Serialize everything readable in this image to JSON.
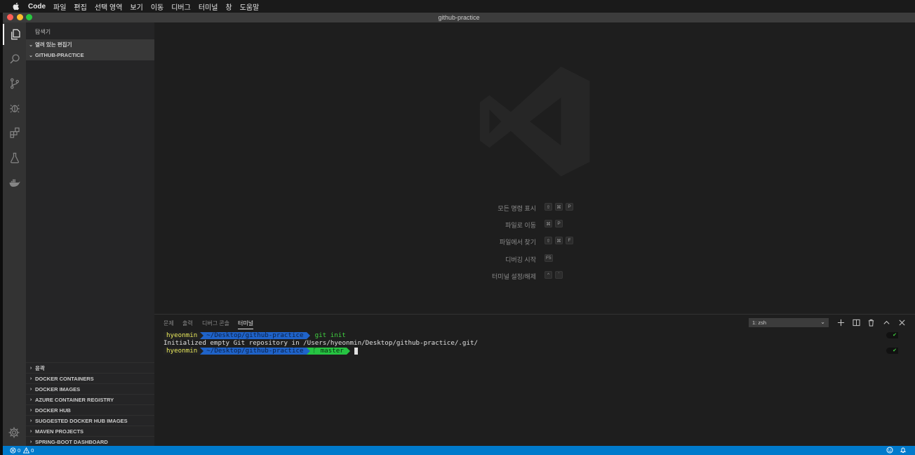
{
  "menubar": {
    "app": "Code",
    "items": [
      "파일",
      "편집",
      "선택 영역",
      "보기",
      "이동",
      "디버그",
      "터미널",
      "창",
      "도움말"
    ]
  },
  "window": {
    "title": "github-practice"
  },
  "activity_bar": {
    "icons": [
      "explorer-icon",
      "search-icon",
      "source-control-icon",
      "debug-icon",
      "extensions-icon",
      "test-flask-icon",
      "docker-icon"
    ],
    "settings_icon": "gear-icon"
  },
  "sidebar": {
    "title": "탐색기",
    "open_editors": "열려 있는 편집기",
    "project": "GITHUB-PRACTICE",
    "sections": [
      "윤곽",
      "DOCKER CONTAINERS",
      "DOCKER IMAGES",
      "AZURE CONTAINER REGISTRY",
      "DOCKER HUB",
      "SUGGESTED DOCKER HUB IMAGES",
      "MAVEN PROJECTS",
      "SPRING-BOOT DASHBOARD"
    ]
  },
  "editor": {
    "hints": [
      {
        "label": "모든 명령 표시",
        "keys": [
          "⇧",
          "⌘",
          "P"
        ]
      },
      {
        "label": "파일로 이동",
        "keys": [
          "⌘",
          "P"
        ]
      },
      {
        "label": "파일에서 찾기",
        "keys": [
          "⇧",
          "⌘",
          "F"
        ]
      },
      {
        "label": "디버깅 시작",
        "keys": [
          "F5"
        ]
      },
      {
        "label": "터미널 설정/해제",
        "keys": [
          "^",
          "`"
        ]
      }
    ]
  },
  "panel": {
    "tabs": [
      "문제",
      "출력",
      "디버그 콘솔",
      "터미널"
    ],
    "active_tab": "터미널",
    "terminal_select": "1: zsh",
    "terminal": {
      "user": "hyeonmin",
      "dir": "~/Desktop/github-practice",
      "command1": "git init",
      "output": "Initialized empty Git repository in /Users/hyeonmin/Desktop/github-practice/.git/",
      "branch": "ᚴ master",
      "status_mark": "✔"
    }
  },
  "statusbar": {
    "errors": "0",
    "warnings": "0"
  },
  "colors": {
    "statusbar": "#007acc",
    "prompt_dir": "#1f63c9",
    "prompt_git": "#26c442",
    "prompt_user": "#e8e85a"
  }
}
